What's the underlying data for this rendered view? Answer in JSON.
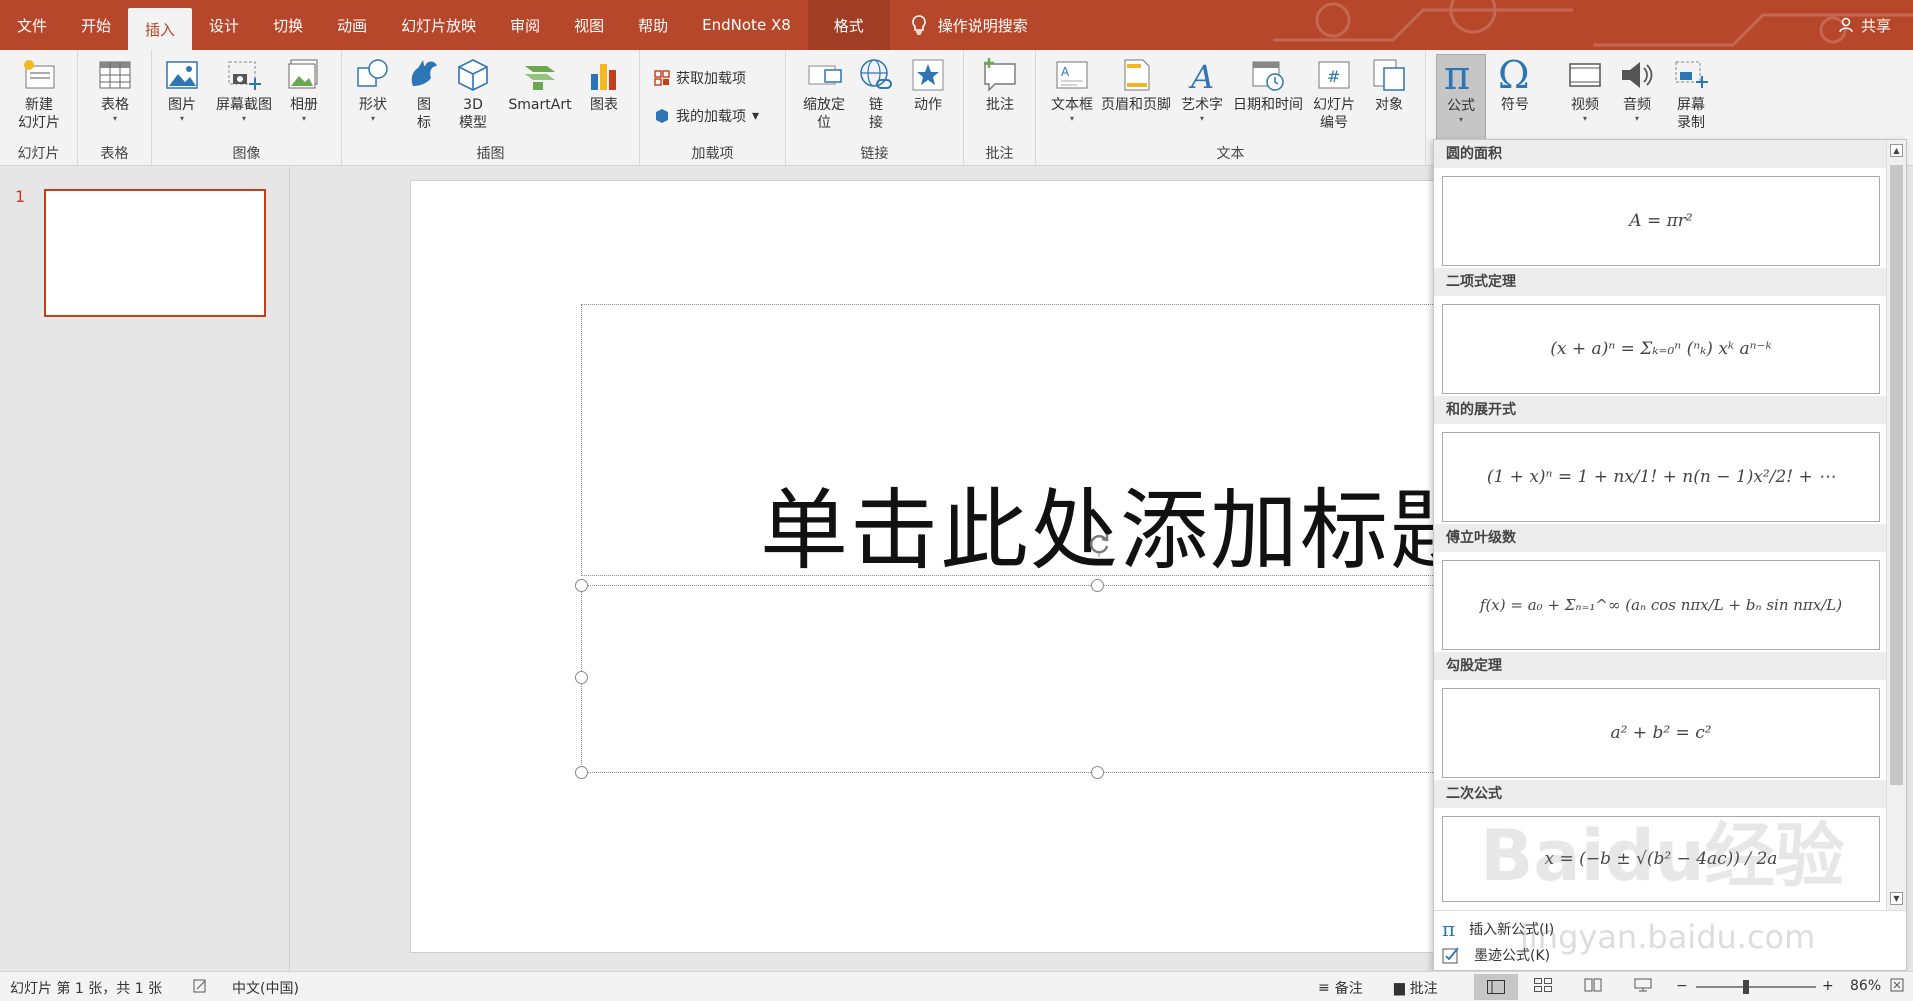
{
  "tabs": [
    {
      "label": "文件"
    },
    {
      "label": "开始"
    },
    {
      "label": "插入"
    },
    {
      "label": "设计"
    },
    {
      "label": "切换"
    },
    {
      "label": "动画"
    },
    {
      "label": "幻灯片放映"
    },
    {
      "label": "审阅"
    },
    {
      "label": "视图"
    },
    {
      "label": "帮助"
    },
    {
      "label": "EndNote X8"
    },
    {
      "label": "格式"
    }
  ],
  "tell_me": "操作说明搜索",
  "share": "共享",
  "ribbon": {
    "groups": {
      "slides": "幻灯片",
      "tables": "表格",
      "images": "图像",
      "illustrations": "插图",
      "addins": "加载项",
      "links": "链接",
      "comments": "批注",
      "text": "文本"
    },
    "buttons": {
      "new_slide_1": "新建",
      "new_slide_2": "幻灯片",
      "table": "表格",
      "pictures": "图片",
      "screenshot": "屏幕截图",
      "album": "相册",
      "shapes": "形状",
      "icons_1": "图",
      "icons_2": "标",
      "model3d_1": "3D",
      "model3d_2": "模型",
      "smartart": "SmartArt",
      "chart": "图表",
      "get_addins": "获取加载项",
      "my_addins": "我的加载项",
      "zoom_1": "缩放定",
      "zoom_2": "位",
      "link_1": "链",
      "link_2": "接",
      "action": "动作",
      "comment": "批注",
      "textbox": "文本框",
      "header_footer": "页眉和页脚",
      "wordart": "艺术字",
      "datetime": "日期和时间",
      "slide_num_1": "幻灯片",
      "slide_num_2": "编号",
      "object": "对象",
      "equation": "公式",
      "symbol": "符号",
      "video": "视频",
      "audio": "音频",
      "screen_rec_1": "屏幕",
      "screen_rec_2": "录制"
    }
  },
  "thumbnail": {
    "number": "1"
  },
  "slide": {
    "title_placeholder": "单击此处添加标题"
  },
  "gallery": {
    "sections": [
      {
        "heading": "圆的面积",
        "formula": "A = πr²"
      },
      {
        "heading": "二项式定理",
        "formula": "(x + a)ⁿ = Σₖ₌₀ⁿ (ⁿₖ) xᵏ aⁿ⁻ᵏ"
      },
      {
        "heading": "和的展开式",
        "formula": "(1 + x)ⁿ = 1 + nx/1! + n(n − 1)x²/2! + ⋯"
      },
      {
        "heading": "傅立叶级数",
        "formula": "f(x) = a₀ + Σₙ₌₁^∞ (aₙ cos nπx/L + bₙ sin nπx/L)"
      },
      {
        "heading": "勾股定理",
        "formula": "a² + b² = c²"
      },
      {
        "heading": "二次公式",
        "formula": "x = (−b ± √(b² − 4ac)) / 2a"
      }
    ],
    "insert_new": "插入新公式(I)",
    "ink_equation": "墨迹公式(K)"
  },
  "status": {
    "slide_info": "幻灯片 第 1 张，共 1 张",
    "language": "中文(中国)",
    "notes": "备注",
    "comments": "批注",
    "zoom_minus": "−",
    "zoom_plus": "+",
    "zoom": "86%"
  },
  "watermark": {
    "logo": "Baidu经验",
    "url": "jingyan.baidu.com"
  },
  "colors": {
    "accent": "#b7472a",
    "selection": "#c43e1c"
  }
}
